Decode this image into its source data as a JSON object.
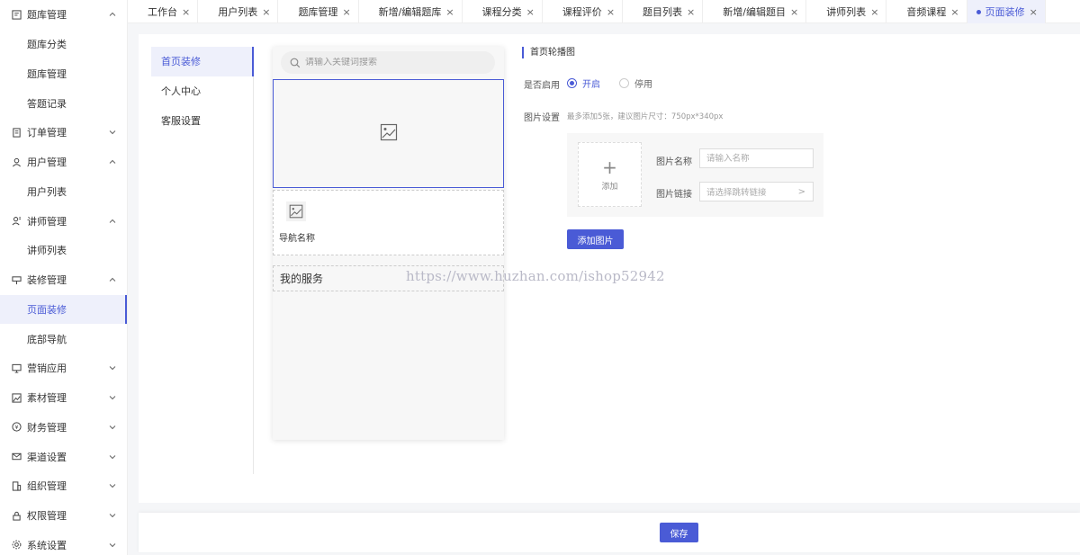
{
  "sidebar": {
    "items": [
      {
        "type": "group",
        "label": "题库管理",
        "icon": "question-bank-icon",
        "expanded": true
      },
      {
        "type": "sub",
        "label": "题库分类"
      },
      {
        "type": "sub",
        "label": "题库管理"
      },
      {
        "type": "sub",
        "label": "答题记录"
      },
      {
        "type": "group",
        "label": "订单管理",
        "icon": "order-icon",
        "expanded": false
      },
      {
        "type": "group",
        "label": "用户管理",
        "icon": "user-icon",
        "expanded": true
      },
      {
        "type": "sub",
        "label": "用户列表"
      },
      {
        "type": "group",
        "label": "讲师管理",
        "icon": "lecturer-icon",
        "expanded": true
      },
      {
        "type": "sub",
        "label": "讲师列表"
      },
      {
        "type": "group",
        "label": "装修管理",
        "icon": "decoration-icon",
        "expanded": true
      },
      {
        "type": "sub",
        "label": "页面装修",
        "active": true
      },
      {
        "type": "sub",
        "label": "底部导航"
      },
      {
        "type": "group",
        "label": "营销应用",
        "icon": "marketing-icon",
        "expanded": false
      },
      {
        "type": "group",
        "label": "素材管理",
        "icon": "material-icon",
        "expanded": false
      },
      {
        "type": "group",
        "label": "财务管理",
        "icon": "finance-icon",
        "expanded": false
      },
      {
        "type": "group",
        "label": "渠道设置",
        "icon": "channel-icon",
        "expanded": false
      },
      {
        "type": "group",
        "label": "组织管理",
        "icon": "organization-icon",
        "expanded": false
      },
      {
        "type": "group",
        "label": "权限管理",
        "icon": "permission-icon",
        "expanded": false
      },
      {
        "type": "group",
        "label": "系统设置",
        "icon": "settings-icon",
        "expanded": false
      }
    ]
  },
  "tabs": [
    {
      "label": "工作台"
    },
    {
      "label": "用户列表"
    },
    {
      "label": "题库管理"
    },
    {
      "label": "新增/编辑题库"
    },
    {
      "label": "课程分类"
    },
    {
      "label": "课程评价"
    },
    {
      "label": "题目列表"
    },
    {
      "label": "新增/编辑题目"
    },
    {
      "label": "讲师列表"
    },
    {
      "label": "音频课程"
    },
    {
      "label": "页面装修",
      "active": true
    }
  ],
  "subnav": [
    {
      "label": "首页装修",
      "active": true
    },
    {
      "label": "个人中心"
    },
    {
      "label": "客服设置"
    }
  ],
  "preview": {
    "search_placeholder": "请输入关键词搜索",
    "nav_label": "导航名称",
    "service_label": "我的服务"
  },
  "settings": {
    "section_title": "首页轮播图",
    "enable_label": "是否启用",
    "enable_on": "开启",
    "enable_off": "停用",
    "enable_value": "开启",
    "image_label": "图片设置",
    "image_hint": "最多添加5张，建议图片尺寸：750px*340px",
    "add_tile_label": "添加",
    "name_label": "图片名称",
    "name_placeholder": "请输入名称",
    "link_label": "图片链接",
    "link_placeholder": "请选择跳转链接",
    "add_image_button": "添加图片"
  },
  "footer": {
    "save_button": "保存"
  },
  "watermark": "https://www.huzhan.com/ishop52942",
  "colors": {
    "accent": "#4a5bd6",
    "active_bg": "#eef0fb"
  }
}
